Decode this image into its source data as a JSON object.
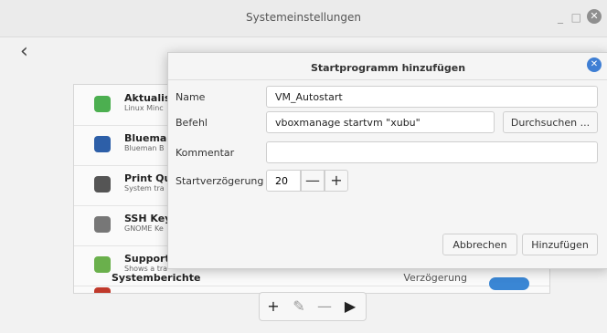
{
  "window": {
    "title": "Systemeinstellungen",
    "minimize": "_",
    "maximize": "□",
    "close": "✕",
    "back": "‹"
  },
  "list": {
    "items": [
      {
        "title": "Aktualis",
        "subtitle": "Linux Minc",
        "icon": "shield-icon",
        "color": "#4caf50"
      },
      {
        "title": "Blueman",
        "subtitle": "Blueman B",
        "icon": "bluetooth-icon",
        "color": "#2d5fa8"
      },
      {
        "title": "Print Qu",
        "subtitle": "System tra",
        "icon": "printer-icon",
        "color": "#555555"
      },
      {
        "title": "SSH Key",
        "subtitle": "GNOME Ke",
        "icon": "key-icon",
        "color": "#777777"
      },
      {
        "title": "Support",
        "subtitle": "Shows a tra",
        "icon": "support-icon",
        "color": "#6ab04c"
      },
      {
        "title": "Systemberichte",
        "subtitle": "",
        "icon": "report-icon",
        "color": "#c0392b",
        "delay_label": "Verzögerung"
      }
    ]
  },
  "bottom": {
    "add": "+",
    "edit": "✎",
    "remove": "—",
    "run": "▶"
  },
  "dialog": {
    "title": "Startprogramm hinzufügen",
    "close": "✕",
    "name_label": "Name",
    "name_value": "VM_Autostart",
    "command_label": "Befehl",
    "command_value": "vboxmanage startvm \"xubu\"",
    "browse": "Durchsuchen ...",
    "comment_label": "Kommentar",
    "comment_value": "",
    "delay_label": "Startverzögerung",
    "delay_value": "20",
    "minus": "—",
    "plus": "+",
    "cancel": "Abbrechen",
    "add": "Hinzufügen"
  }
}
